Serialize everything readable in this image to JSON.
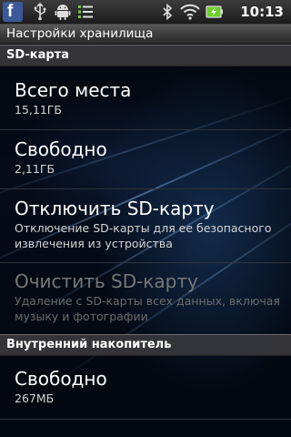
{
  "status_bar": {
    "time": "10:13",
    "icons": [
      "facebook-icon",
      "usb-icon",
      "android-debug-icon",
      "sync-icon",
      "bluetooth-icon",
      "wifi-icon",
      "battery-charging-icon"
    ],
    "facebook_glyph": "f"
  },
  "title_bar": {
    "title": "Настройки хранилища"
  },
  "sections": {
    "sd_card": {
      "header": "SD-карта",
      "total": {
        "title": "Всего места",
        "summary": "15,11ГБ"
      },
      "free": {
        "title": "Свободно",
        "summary": "2,11ГБ"
      },
      "unmount": {
        "title": "Отключить SD-карту",
        "summary": "Отключение SD-карты для ее безопасного извлечения из устройства"
      },
      "format": {
        "title": "Очистить SD-карту",
        "summary": "Удаление с SD-карты всех данных, включая музыку и фотографии",
        "enabled": false
      }
    },
    "internal": {
      "header": "Внутренний накопитель",
      "free": {
        "title": "Свободно",
        "summary": "267МБ"
      }
    }
  },
  "colors": {
    "text_primary": "#ffffff",
    "text_secondary": "#d4d4d4",
    "text_disabled": "#777777",
    "battery_green": "#6ccf2b",
    "facebook_blue": "#3b5998"
  }
}
